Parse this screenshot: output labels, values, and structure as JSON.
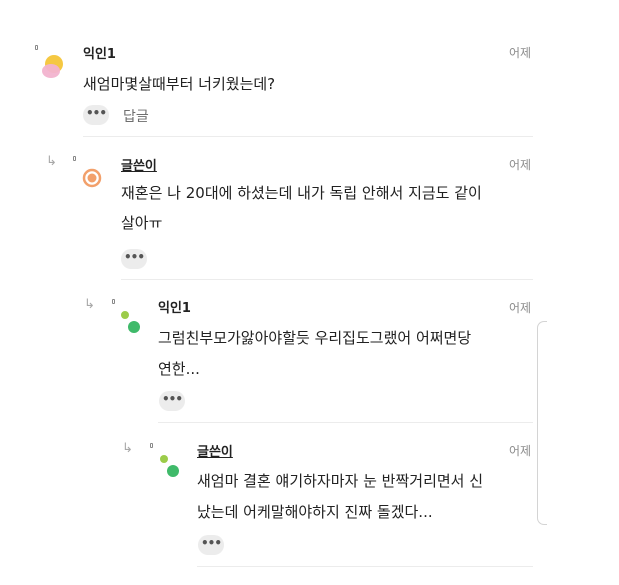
{
  "comments": [
    {
      "author": "익인1",
      "time": "어제",
      "lines": [
        "새엄마몇살때부터 너키웠는데?"
      ],
      "more": "•••",
      "reply_label": "답글"
    },
    {
      "author": "글쓴이",
      "time": "어제",
      "lines": [
        "재혼은 나 20대에 하셨는데 내가 독립 안해서 지금도 같이",
        "살아ㅠ"
      ],
      "more": "•••"
    },
    {
      "author": "익인1",
      "time": "어제",
      "lines": [
        "그럼친부모가앓아야할듯 우리집도그랬어 어쩌면당",
        "연한..."
      ],
      "more": "•••"
    },
    {
      "author": "글쓴이",
      "time": "어제",
      "lines": [
        "새엄마 결혼 얘기하자마자 눈 반짝거리면서 신",
        "났는데 어케말해야하지 진짜 돌겠다..."
      ],
      "more": "•••"
    }
  ],
  "icons": {
    "reply_arrow": "↳",
    "avatar_1": "yellow-pink-blob-avatar",
    "avatar_2": "orange-ring-avatar",
    "avatar_3": "green-dots-avatar",
    "avatar_4": "green-dots-avatar"
  },
  "colors": {
    "avatar_yellow": "#f5c842",
    "avatar_pink": "#f2b3cf",
    "avatar_orange": "#f2a06b",
    "avatar_green_light": "#9ccc4a",
    "avatar_green": "#3fba6a",
    "text_primary": "#222222",
    "text_muted": "#8c8c8c",
    "button_bg": "#ececec"
  }
}
